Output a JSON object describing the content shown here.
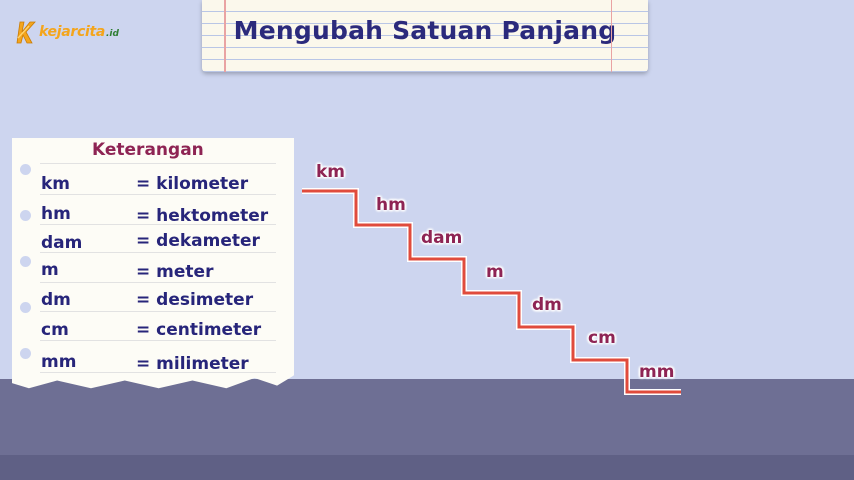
{
  "logo": {
    "text": "kejarcita",
    "suffix": ".id",
    "icon": "logo-mark"
  },
  "title": "Mengubah Satuan Panjang",
  "legend": {
    "title": "Keterangan",
    "rows": [
      {
        "abbr": "km",
        "definition": "= kilometer"
      },
      {
        "abbr": "hm",
        "definition": "=  hektometer"
      },
      {
        "abbr": "dam",
        "definition": "= dekameter"
      },
      {
        "abbr": "m",
        "definition": "= meter"
      },
      {
        "abbr": "dm",
        "definition": "= desimeter"
      },
      {
        "abbr": "cm",
        "definition": "= centimeter"
      },
      {
        "abbr": "mm",
        "definition": "= milimeter"
      }
    ]
  },
  "stairs": {
    "steps": [
      "km",
      "hm",
      "dam",
      "m",
      "dm",
      "cm",
      "mm"
    ],
    "line_color": "#e04b3c",
    "label_color": "#8e2454"
  },
  "colors": {
    "background": "#cdd5ef",
    "floor": "#6e6f94",
    "title": "#2b2a7c",
    "accent": "#f4a51c"
  }
}
